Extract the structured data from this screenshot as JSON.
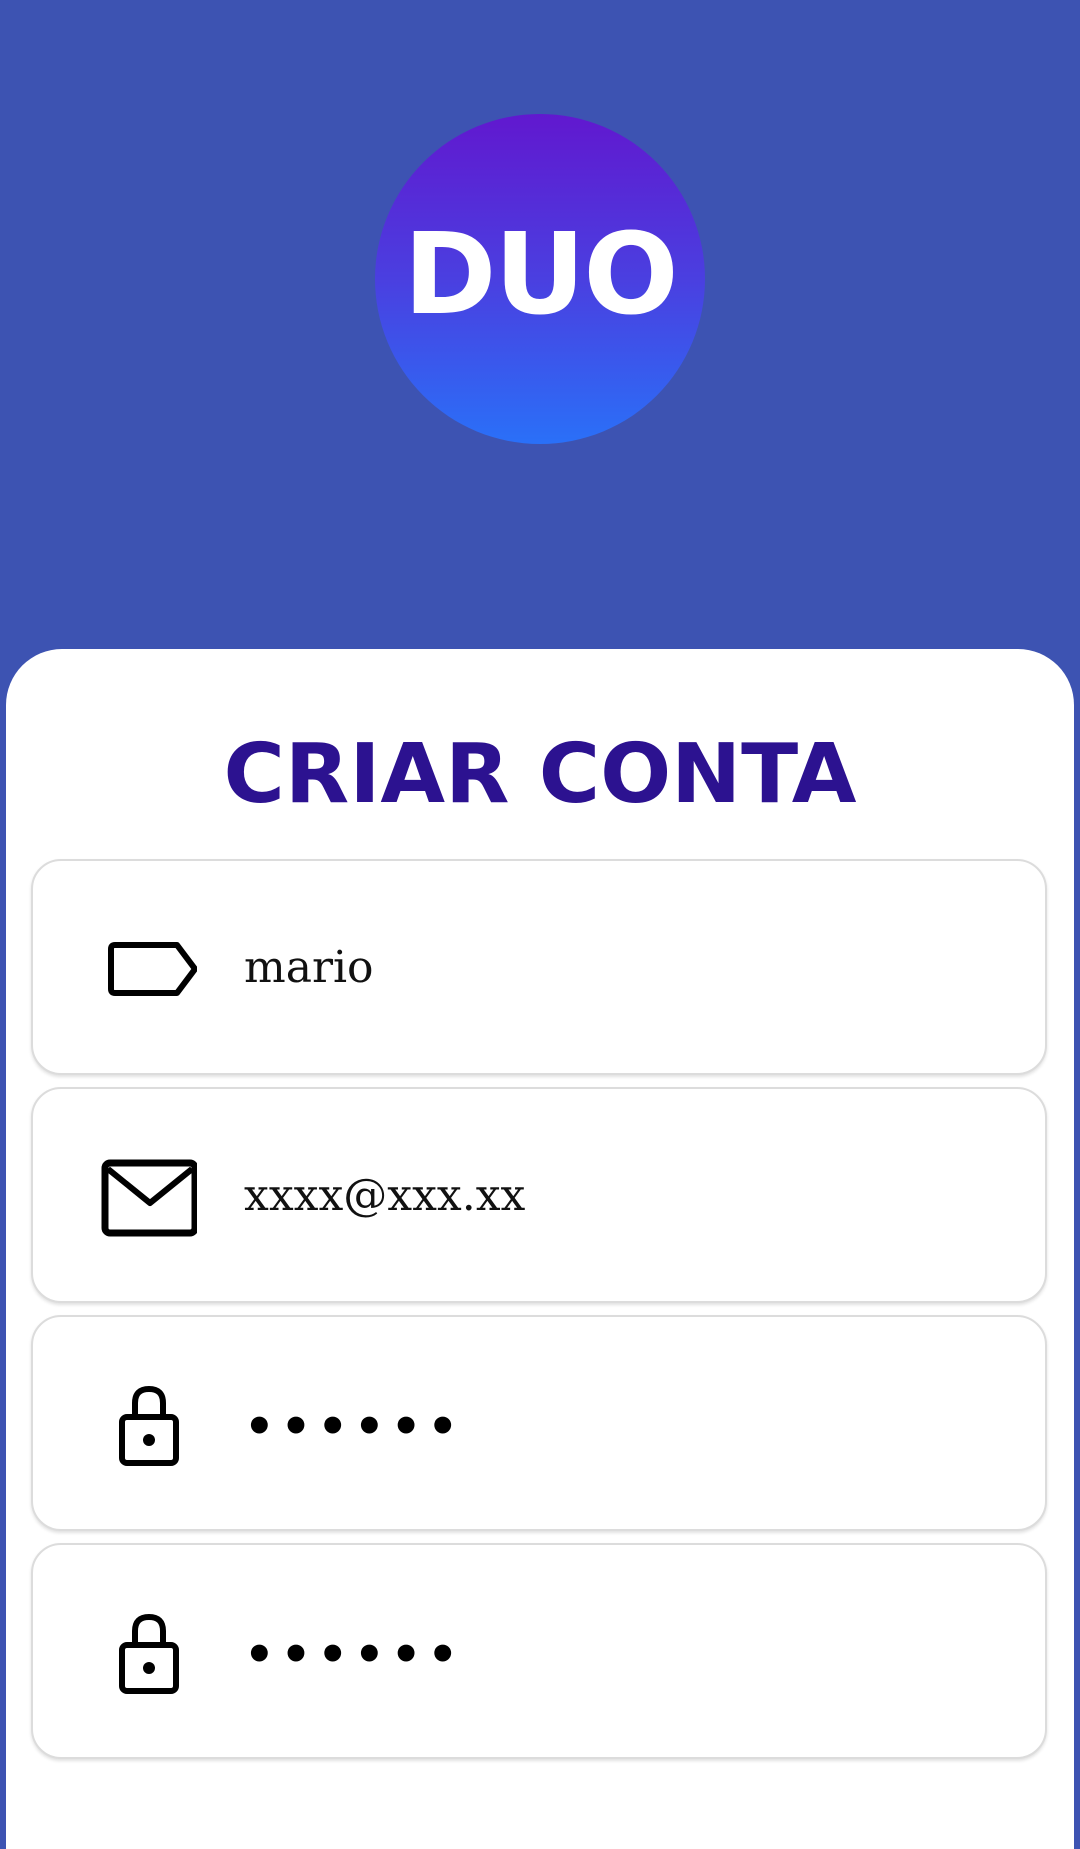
{
  "logo": {
    "text": "DUO",
    "gradient_top": "#6118cf",
    "gradient_bottom": "#2a70f8"
  },
  "colors": {
    "background": "#3d53b2",
    "card": "#ffffff",
    "title": "#2c1290"
  },
  "form": {
    "title": "CRIAR CONTA",
    "fields": [
      {
        "icon": "label-tag-icon",
        "value": "mario"
      },
      {
        "icon": "mail-icon",
        "value": "xxxx@xxx.xx"
      },
      {
        "icon": "lock-icon",
        "value": "••••••"
      },
      {
        "icon": "lock-icon",
        "value": "••••••"
      }
    ]
  }
}
